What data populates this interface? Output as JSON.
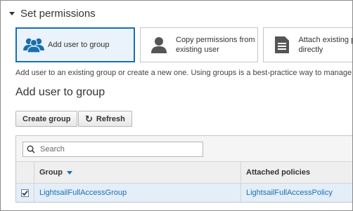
{
  "section": {
    "title": "Set permissions"
  },
  "options": [
    {
      "label": "Add user to group",
      "icon": "users-group-icon",
      "selected": true
    },
    {
      "label": "Copy permissions from existing user",
      "icon": "user-icon",
      "selected": false
    },
    {
      "label": "Attach existing po directly",
      "icon": "document-icon",
      "selected": false
    }
  ],
  "description": "Add user to an existing group or create a new one. Using groups is a best-practice way to manage user's",
  "subtitle": "Add user to group",
  "toolbar": {
    "create_label": "Create group",
    "refresh_label": "Refresh"
  },
  "search": {
    "placeholder": "Search",
    "value": ""
  },
  "table": {
    "columns": [
      "Group",
      "Attached policies"
    ],
    "rows": [
      {
        "group": "LightsailFullAccessGroup",
        "policy": "LightsailFullAccessPolicy",
        "checked": true
      }
    ]
  },
  "colors": {
    "accent": "#1a6fb0",
    "selected_bg": "#eaf3fb",
    "row_selected_bg": "#e3eef9"
  }
}
